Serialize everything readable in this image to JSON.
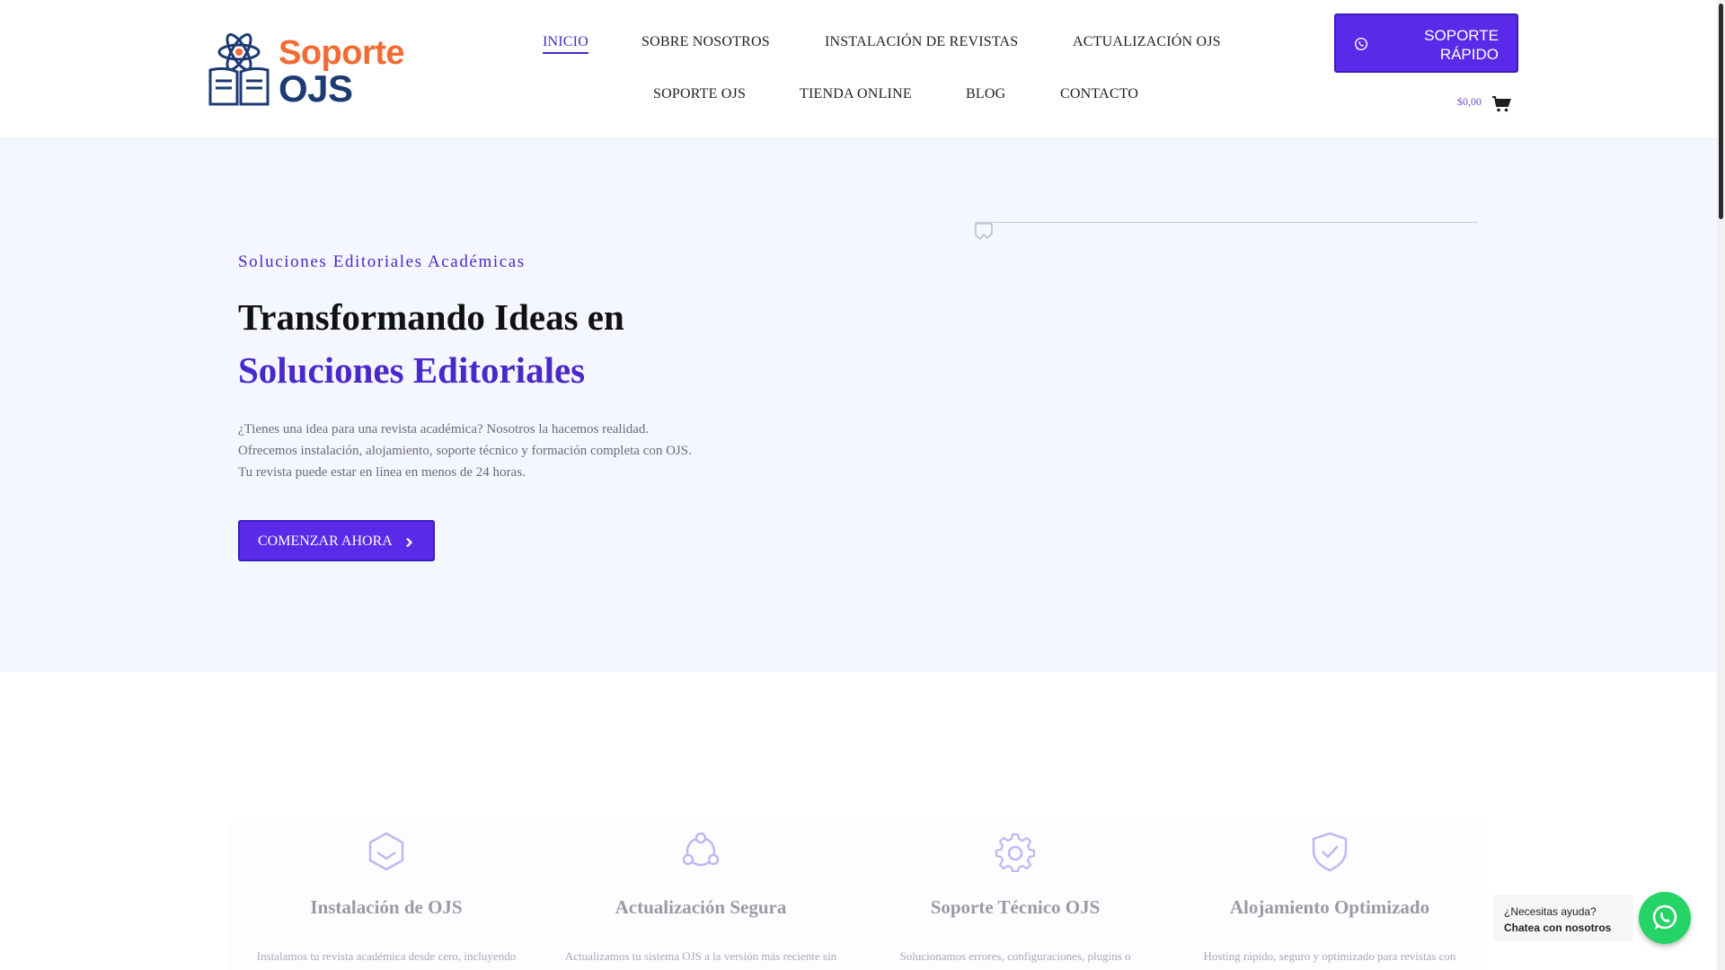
{
  "logo": {
    "word1": "Soporte",
    "word2": "OJS"
  },
  "nav": {
    "items": [
      {
        "label": "INICIO",
        "active": true
      },
      {
        "label": "SOBRE NOSOTROS"
      },
      {
        "label": "INSTALACIÓN DE REVISTAS"
      },
      {
        "label": "ACTUALIZACIÓN OJS"
      },
      {
        "label": "SOPORTE OJS"
      },
      {
        "label": "TIENDA ONLINE"
      },
      {
        "label": "BLOG"
      },
      {
        "label": "CONTACTO"
      }
    ]
  },
  "quick_support": {
    "line1": "SOPORTE",
    "line2": "RÁPIDO",
    "icon": "whatsapp-icon"
  },
  "cart": {
    "total": "$0,00",
    "icon": "cart-icon"
  },
  "hero": {
    "eyebrow": "Soluciones Editoriales Académicas",
    "title_line1": "Transformando Ideas en",
    "title_line2": "Soluciones Editoriales",
    "description": [
      "¿Tienes una idea para una revista académica? Nosotros la hacemos realidad.",
      "Ofrecemos instalación, alojamiento, soporte técnico y formación completa con OJS.",
      "Tu revista puede estar en línea en menos de 24 horas."
    ],
    "cta_label": "COMENZAR AHORA"
  },
  "services": [
    {
      "title": "Instalación de OJS",
      "desc": "Instalamos tu revista académica desde cero, incluyendo",
      "icon": "hexagon-chevron-icon"
    },
    {
      "title": "Actualización Segura",
      "desc": "Actualizamos tu sistema OJS a la versión más reciente sin",
      "icon": "network-nodes-icon"
    },
    {
      "title": "Soporte Técnico OJS",
      "desc": "Solucionamos errores, configuraciones, plugins o",
      "icon": "gear-icon"
    },
    {
      "title": "Alojamiento Optimizado",
      "desc": "Hosting rápido, seguro y optimizado para revistas con",
      "icon": "shield-check-icon"
    }
  ],
  "chat": {
    "line1": "¿Necesitas ayuda?",
    "line2": "Chatea con nosotros",
    "icon": "whatsapp-icon"
  },
  "colors": {
    "primary": "#5a2ae8",
    "accent": "#4b28c9",
    "logo_orange": "#f36b32",
    "logo_navy": "#1d3a73",
    "hero_bg": "#f4f7ff",
    "whatsapp": "#25d366"
  }
}
